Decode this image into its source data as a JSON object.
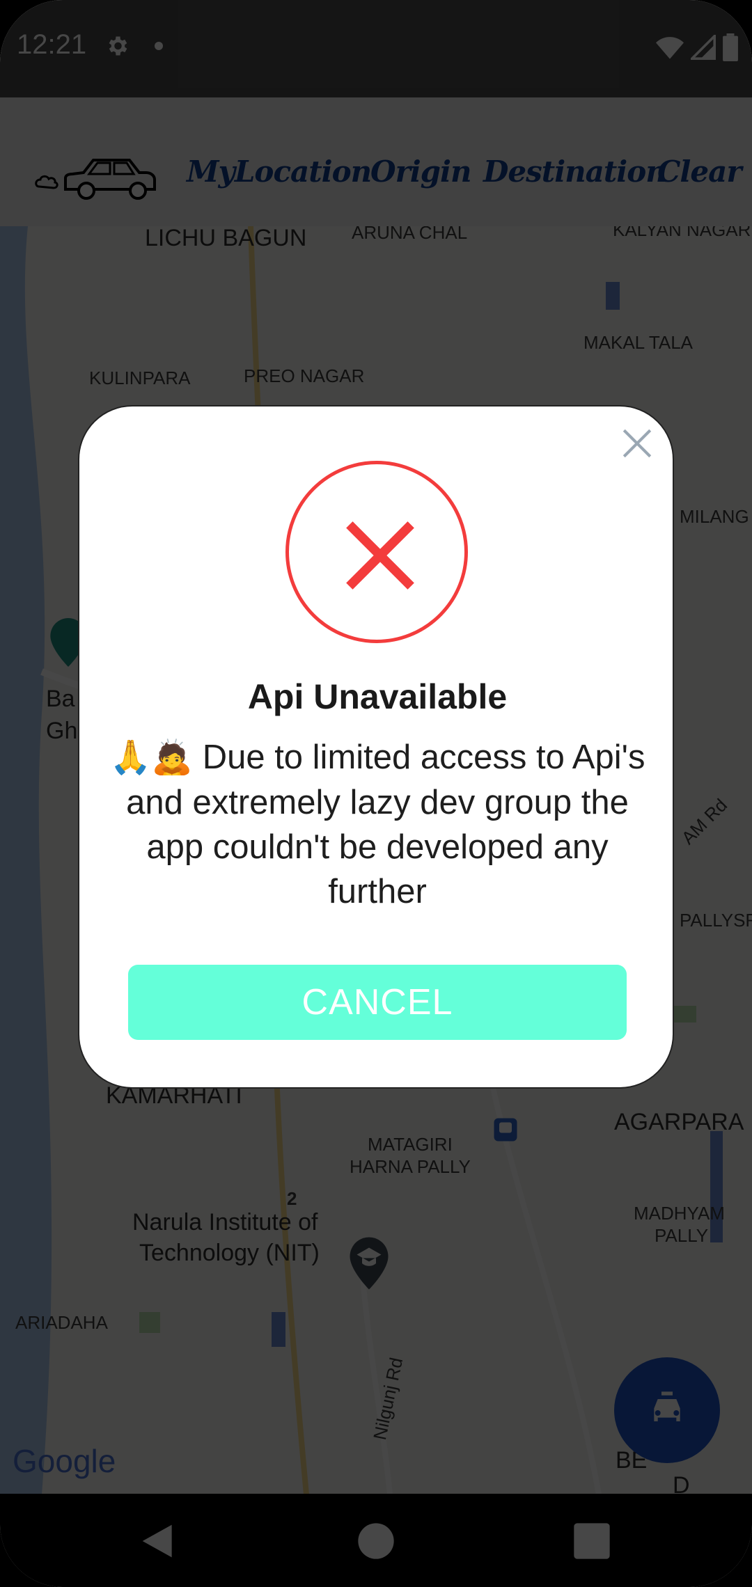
{
  "status_bar": {
    "time": "12:21",
    "icons": [
      "gear-icon",
      "notification-dot-icon",
      "wifi-icon",
      "signal-icon",
      "battery-icon"
    ]
  },
  "app_bar": {
    "logo_icon": "car-icon",
    "links": [
      "MyLocation",
      "Origin",
      "Destination",
      "Clear"
    ]
  },
  "map": {
    "labels": [
      "LICHU BAGUN",
      "ARUNA CHAL",
      "KALYAN NAGAR",
      "MAKAL TALA",
      "KULINPARA",
      "PREO NAGAR",
      "MILANG",
      "KAMARHATI",
      "AGARPARA",
      "MATAGIRI",
      "HARNA PALLY",
      "Narula Institute of",
      "Technology (NIT)",
      "MADHYAM",
      "PALLY",
      "ARIADAHA",
      "Nilgunj Rd",
      "AM Rd",
      "PALLYSR",
      "Ba",
      "Gh",
      "BE",
      "D",
      "2"
    ],
    "branding": "Google",
    "fab_icon": "car-side-icon"
  },
  "dialog": {
    "title": "Api Unavailable",
    "emoji": "🙏🙇",
    "message": "Due to limited access to Api's and extremely lazy dev group the app couldn't be developed any further",
    "cancel_label": "CANCEL",
    "close_icon": "close-icon",
    "error_icon": "error-x-icon",
    "colors": {
      "error": "#f33c3c",
      "button": "#64ffd9",
      "nav_link": "#0f3e8f"
    }
  },
  "nav_bar": {
    "icons": [
      "back-icon",
      "home-icon",
      "recents-icon"
    ]
  }
}
